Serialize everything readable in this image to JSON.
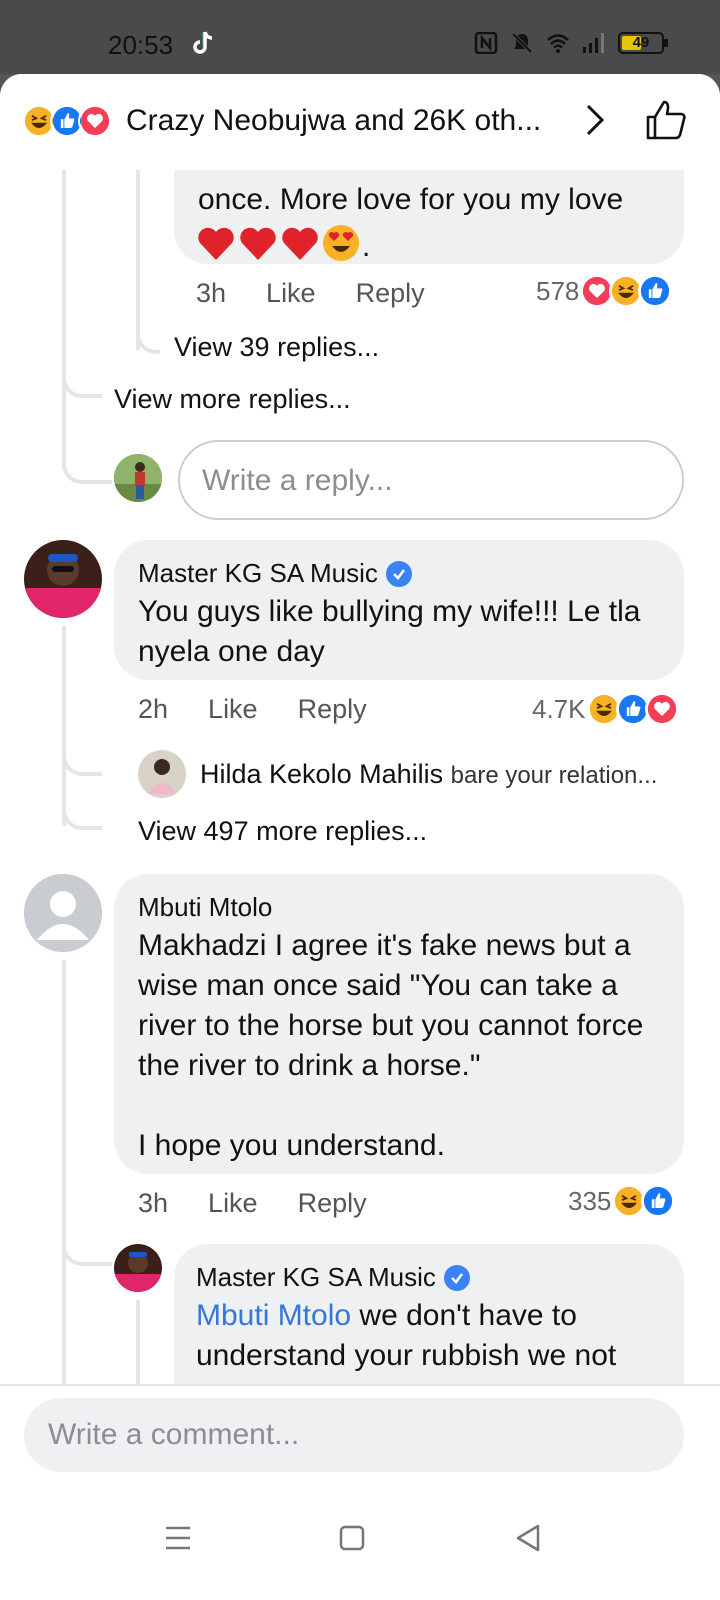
{
  "status_bar": {
    "time": "20:53",
    "battery": "49",
    "battery_level": 0.49
  },
  "header": {
    "title": "Crazy Neobujwa and 26K oth..."
  },
  "comments": {
    "c0": {
      "text": "once. More love for you my love",
      "time": "3h",
      "like": "Like",
      "reply": "Reply",
      "count": "578",
      "view_replies": "View 39 replies..."
    },
    "view_more": "View more replies...",
    "reply_placeholder": "Write a reply...",
    "c1": {
      "author": "Master KG SA Music",
      "text": "You guys like bullying my wife!!! Le tla nyela one day",
      "time": "2h",
      "like": "Like",
      "reply": "Reply",
      "count": "4.7K",
      "preview_author": "Hilda Kekolo Mahilis",
      "preview_snippet": "bare your relation...",
      "view_replies": "View 497 more replies..."
    },
    "c2": {
      "author": "Mbuti Mtolo",
      "text_lines": [
        "Makhadzi I agree it's fake news but a",
        "wise man once said \"You can take a",
        "river to the horse but you cannot force",
        "the river to drink a horse.\""
      ],
      "text_end": "I hope you understand.",
      "time": "3h",
      "like": "Like",
      "reply": "Reply",
      "count": "335"
    },
    "c3": {
      "author": "Master KG SA Music",
      "mention": "Mbuti Mtolo",
      "text_line1": " we don't have to",
      "text_line2": "understand your rubbish we not"
    }
  },
  "composer": {
    "placeholder": "Write a comment..."
  },
  "colors": {
    "like_blue": "#1877f2",
    "love_red": "#f33e58",
    "haha_yellow": "#f7b125",
    "verified": "#3b82f6",
    "mention": "#3577d9"
  },
  "icons": [
    "tiktok-icon",
    "nfc-icon",
    "mute-icon",
    "wifi-icon",
    "signal-icon",
    "battery-icon",
    "chevron-right-icon",
    "like-thumb-icon",
    "menu-icon",
    "home-icon",
    "back-icon"
  ]
}
